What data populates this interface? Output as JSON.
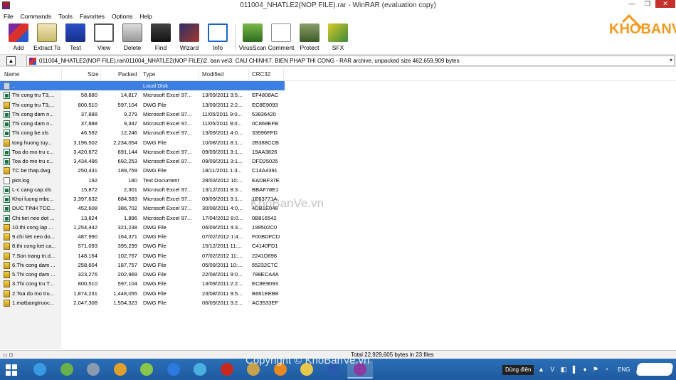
{
  "window": {
    "title": "011004_NHATLE2(NOP FILE).rar - WinRAR (evaluation copy)",
    "min_glyph": "—",
    "max_glyph": "❐",
    "close_glyph": "✕"
  },
  "menu": [
    "File",
    "Commands",
    "Tools",
    "Favorites",
    "Options",
    "Help"
  ],
  "toolbar": [
    {
      "label": "Add",
      "icon": "add-icon"
    },
    {
      "label": "Extract To",
      "icon": "extract-to-icon"
    },
    {
      "label": "Test",
      "icon": "test-icon"
    },
    {
      "label": "View",
      "icon": "view-icon"
    },
    {
      "label": "Delete",
      "icon": "delete-icon"
    },
    {
      "label": "Find",
      "icon": "find-icon"
    },
    {
      "label": "Wizard",
      "icon": "wizard-icon"
    },
    {
      "label": "Info",
      "icon": "info-icon"
    },
    {
      "label": "VirusScan",
      "icon": "virus-scan-icon"
    },
    {
      "label": "Comment",
      "icon": "comment-icon"
    },
    {
      "label": "Protect",
      "icon": "protect-icon"
    },
    {
      "label": "SFX",
      "icon": "sfx-icon"
    }
  ],
  "brand": {
    "text": "KHOBANVE"
  },
  "address": {
    "up_glyph": "▲",
    "path": "011004_NHATLE2(NOP FILE).rar\\011004_NHATLE2(NOP FILE)\\2. ban ve\\3. CAU CHINH\\7. BIEN PHAP THI CONG - RAR archive, unpacked size 462,659,909 bytes",
    "dropdown_glyph": "▾"
  },
  "columns": {
    "name": "Name",
    "size": "Size",
    "packed": "Packed",
    "type": "Type",
    "modified": "Modified",
    "crc": "CRC32"
  },
  "files": [
    {
      "name": "..",
      "size": "",
      "packed": "",
      "type": "Local Disk",
      "modified": "",
      "crc": "",
      "kind": "up",
      "selected": true
    },
    {
      "name": "Thi cong tru T3,...",
      "size": "58,880",
      "packed": "14,817",
      "type": "Microsoft Excel 97...",
      "modified": "13/09/2011 3:5...",
      "crc": "EF4808AC",
      "kind": "excel"
    },
    {
      "name": "Thi cong tru T3,...",
      "size": "800,510",
      "packed": "597,104",
      "type": "DWG File",
      "modified": "13/09/2011 2:2...",
      "crc": "EC8E9093",
      "kind": "dwg"
    },
    {
      "name": "Thi cong dam n...",
      "size": "37,888",
      "packed": "9,279",
      "type": "Microsoft Excel 97...",
      "modified": "11/05/2011 9:0...",
      "crc": "53836420",
      "kind": "excel"
    },
    {
      "name": "Thi cong dam n...",
      "size": "37,888",
      "packed": "9,347",
      "type": "Microsoft Excel 97...",
      "modified": "11/05/2011 9:0...",
      "crc": "0C869EFB",
      "kind": "excel"
    },
    {
      "name": "Thi cong be.xls",
      "size": "46,592",
      "packed": "12,246",
      "type": "Microsoft Excel 97...",
      "modified": "13/09/2011 4:0...",
      "crc": "33596FFD",
      "kind": "excel"
    },
    {
      "name": "tong huong tuy...",
      "size": "3,196,502",
      "packed": "2,234,054",
      "type": "DWG File",
      "modified": "10/08/2011 8:1...",
      "crc": "2B388CCB",
      "kind": "dwg"
    },
    {
      "name": "Toa do mo tru c...",
      "size": "3,420,672",
      "packed": "691,144",
      "type": "Microsoft Excel 97...",
      "modified": "09/09/2011 3:1...",
      "crc": "19AA3826",
      "kind": "excel"
    },
    {
      "name": "Toa do mo tru c...",
      "size": "3,434,496",
      "packed": "692,253",
      "type": "Microsoft Excel 97...",
      "modified": "09/09/2011 3:1...",
      "crc": "DFD25025",
      "kind": "excel"
    },
    {
      "name": "TC be thap.dwg",
      "size": "250,431",
      "packed": "189,759",
      "type": "DWG File",
      "modified": "18/11/2011 1:3...",
      "crc": "C14A4391",
      "kind": "dwg"
    },
    {
      "name": "plot.log",
      "size": "192",
      "packed": "180",
      "type": "Text Document",
      "modified": "28/03/2012 10:...",
      "crc": "EADBF37E",
      "kind": "txt"
    },
    {
      "name": "L-c cang cap.xls",
      "size": "15,872",
      "packed": "2,301",
      "type": "Microsoft Excel 97...",
      "modified": "13/12/2011 8:3...",
      "crc": "BBAF78E1",
      "kind": "excel"
    },
    {
      "name": "Khoi luong mbc...",
      "size": "3,397,632",
      "packed": "684,583",
      "type": "Microsoft Excel 97...",
      "modified": "09/09/2011 3:1...",
      "crc": "1E63771A",
      "kind": "excel"
    },
    {
      "name": "DUC TINH TCC...",
      "size": "452,608",
      "packed": "386,702",
      "type": "Microsoft Excel 97...",
      "modified": "30/08/2011 4:0...",
      "crc": "4DB1E048",
      "kind": "excel"
    },
    {
      "name": "Chi tiet neo dot ...",
      "size": "13,824",
      "packed": "1,896",
      "type": "Microsoft Excel 97...",
      "modified": "17/04/2012 8:0...",
      "crc": "0B816542",
      "kind": "excel"
    },
    {
      "name": "10.thi cong lap ...",
      "size": "1,254,442",
      "packed": "321,238",
      "type": "DWG File",
      "modified": "06/09/2011 4:3...",
      "crc": "199502C0",
      "kind": "dwg"
    },
    {
      "name": "9.chi tiet neo do...",
      "size": "487,990",
      "packed": "164,371",
      "type": "DWG File",
      "modified": "07/02/2012 1:4...",
      "crc": "F00BDFCD",
      "kind": "dwg"
    },
    {
      "name": "8.thi cong ket ca...",
      "size": "571,093",
      "packed": "395,299",
      "type": "DWG File",
      "modified": "15/12/2011 11:...",
      "crc": "C4140FD1",
      "kind": "dwg"
    },
    {
      "name": "7.Son trang tri.d...",
      "size": "148,164",
      "packed": "102,767",
      "type": "DWG File",
      "modified": "07/02/2012 11:...",
      "crc": "2241D696",
      "kind": "dwg"
    },
    {
      "name": "6.Thi cong dam ...",
      "size": "258,604",
      "packed": "187,757",
      "type": "DWG File",
      "modified": "05/09/2011 10:...",
      "crc": "55232C7C",
      "kind": "dwg"
    },
    {
      "name": "5.Thi cong dam ...",
      "size": "323,276",
      "packed": "202,969",
      "type": "DWG File",
      "modified": "22/08/2011 9:0...",
      "crc": "788ECA4A",
      "kind": "dwg"
    },
    {
      "name": "3.Thi cong tru T...",
      "size": "800,510",
      "packed": "597,104",
      "type": "DWG File",
      "modified": "13/09/2011 2:2...",
      "crc": "EC8E9093",
      "kind": "dwg"
    },
    {
      "name": "2.Toa do mo tru...",
      "size": "1,874,231",
      "packed": "1,448,055",
      "type": "DWG File",
      "modified": "23/08/2011 9:5...",
      "crc": "B661EEB8",
      "kind": "dwg"
    },
    {
      "name": "1.matbangtruoc...",
      "size": "2,047,308",
      "packed": "1,554,323",
      "type": "DWG File",
      "modified": "06/09/2011 3:2...",
      "crc": "AC3533EF",
      "kind": "dwg"
    }
  ],
  "status": {
    "text": "Total 22,929,605 bytes in 23 files"
  },
  "taskbar": {
    "apps": [
      {
        "icon": "internet-explorer-icon",
        "color": "#3a9be0"
      },
      {
        "icon": "utorrent-icon",
        "color": "#6ab04a"
      },
      {
        "icon": "media-player-icon",
        "color": "#8a9ab0"
      },
      {
        "icon": "chrome-icon",
        "color": "#e0a02a"
      },
      {
        "icon": "coc-coc-icon",
        "color": "#8ac64a"
      },
      {
        "icon": "zalo-icon",
        "color": "#2a7ae0"
      },
      {
        "icon": "p-app-icon",
        "color": "#4ab0e0"
      },
      {
        "icon": "autocad-icon",
        "color": "#c8281e"
      },
      {
        "icon": "email-app-icon",
        "color": "#c8a04a"
      },
      {
        "icon": "foxit-icon",
        "color": "#e8881e"
      },
      {
        "icon": "file-explorer-icon",
        "color": "#e8c84a"
      },
      {
        "icon": "word-icon",
        "color": "#2a5aae"
      },
      {
        "icon": "winrar-icon",
        "color": "#8a3aa0"
      }
    ],
    "tray_label": "Dùng điện",
    "tray_icons": "▲ V ◧ ▌ ♦ ⚑ ◔",
    "language": "ENG"
  },
  "watermarks": {
    "middle": "KhoBanVe.vn",
    "bottom": "Copyright © KhoBanVe.vn"
  }
}
